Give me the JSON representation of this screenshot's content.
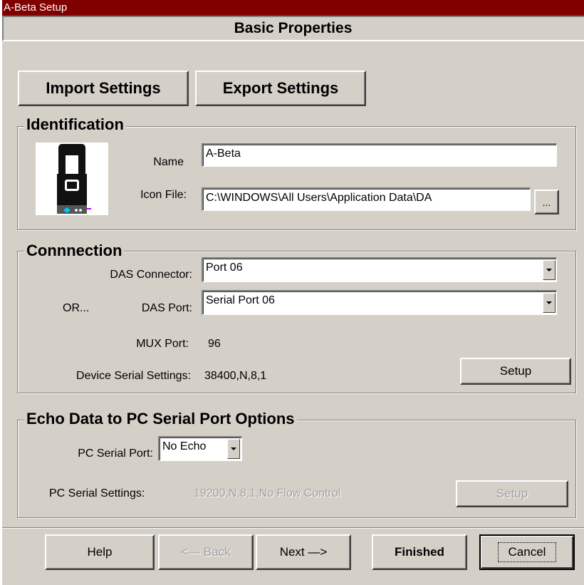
{
  "window": {
    "title": "A-Beta Setup"
  },
  "header": {
    "title": "Basic Properties"
  },
  "toolbar": {
    "import_label": "Import Settings",
    "export_label": "Export Settings"
  },
  "identification": {
    "legend": "Identification",
    "name_label": "Name",
    "name_value": "A-Beta",
    "icon_label": "Icon File:",
    "icon_value": "C:\\WINDOWS\\All Users\\Application Data\\DA",
    "browse_label": "..."
  },
  "connection": {
    "legend": "Connnection",
    "connector_label": "DAS Connector:",
    "connector_value": "Port 06",
    "or_label": "OR...",
    "port_label": "DAS Port:",
    "port_value": "Serial Port 06",
    "mux_label": "MUX Port:",
    "mux_value": "96",
    "serial_label": "Device Serial Settings:",
    "serial_value": "38400,N,8,1",
    "setup_label": "Setup"
  },
  "echo": {
    "legend": "Echo Data to PC Serial Port Options",
    "pc_port_label": "PC Serial Port:",
    "pc_port_value": "No Echo",
    "pc_settings_label": "PC Serial Settings:",
    "pc_settings_value": "19200,N,8,1,No Flow Control",
    "setup_label": "Setup"
  },
  "footer": {
    "help_label": "Help",
    "back_label": "<— Back",
    "next_label": "Next —>",
    "finished_label": "Finished",
    "cancel_label": "Cancel"
  },
  "colors": {
    "titlebar": "#800000",
    "face": "#d4d0c8",
    "disabled_text": "#a0a0a0"
  },
  "icons": {
    "device_icon": "device-icon",
    "dropdown": "chevron-down-icon"
  }
}
